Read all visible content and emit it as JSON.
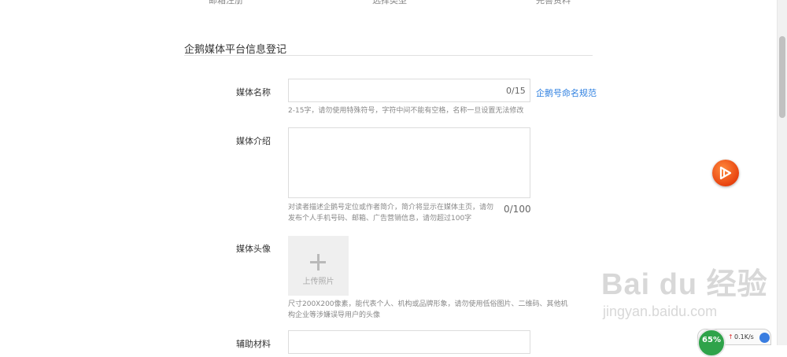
{
  "top_steps": [
    "邮箱注册",
    "选择类型",
    "完善资料"
  ],
  "section_title": "企鹅媒体平台信息登记",
  "fields": {
    "media_name": {
      "label": "媒体名称",
      "value": "",
      "counter": "0/15",
      "link": "企鹅号命名规范",
      "hint": "2-15字，请勿使用特殊符号，字符中间不能有空格，名称一旦设置无法修改"
    },
    "media_intro": {
      "label": "媒体介绍",
      "value": "",
      "counter": "0/100",
      "hint_line1": "对读者描述企鹅号定位或作者简介，简介将显示在媒体主页，请勿",
      "hint_line2": "发布个人手机号码、邮箱、广告营销信息，请勿超过100字"
    },
    "media_avatar": {
      "label": "媒体头像",
      "upload_label": "上传照片",
      "hint_line1": "尺寸200X200像素，能代表个人、机构或品牌形象，请勿使用低俗图片、二维码、其他机",
      "hint_line2": "构企业等涉嫌误导用户的头像"
    },
    "support_material": {
      "label": "辅助材料"
    }
  },
  "watermark": {
    "main": "Bai du 经验",
    "sub": "jingyan.baidu.com"
  },
  "net_widget": {
    "percent": "65%",
    "speed": "0.1K/s"
  },
  "icons": {
    "float": "play-app-icon",
    "upload": "plus-icon",
    "up_arrow": "arrow-up-icon"
  }
}
